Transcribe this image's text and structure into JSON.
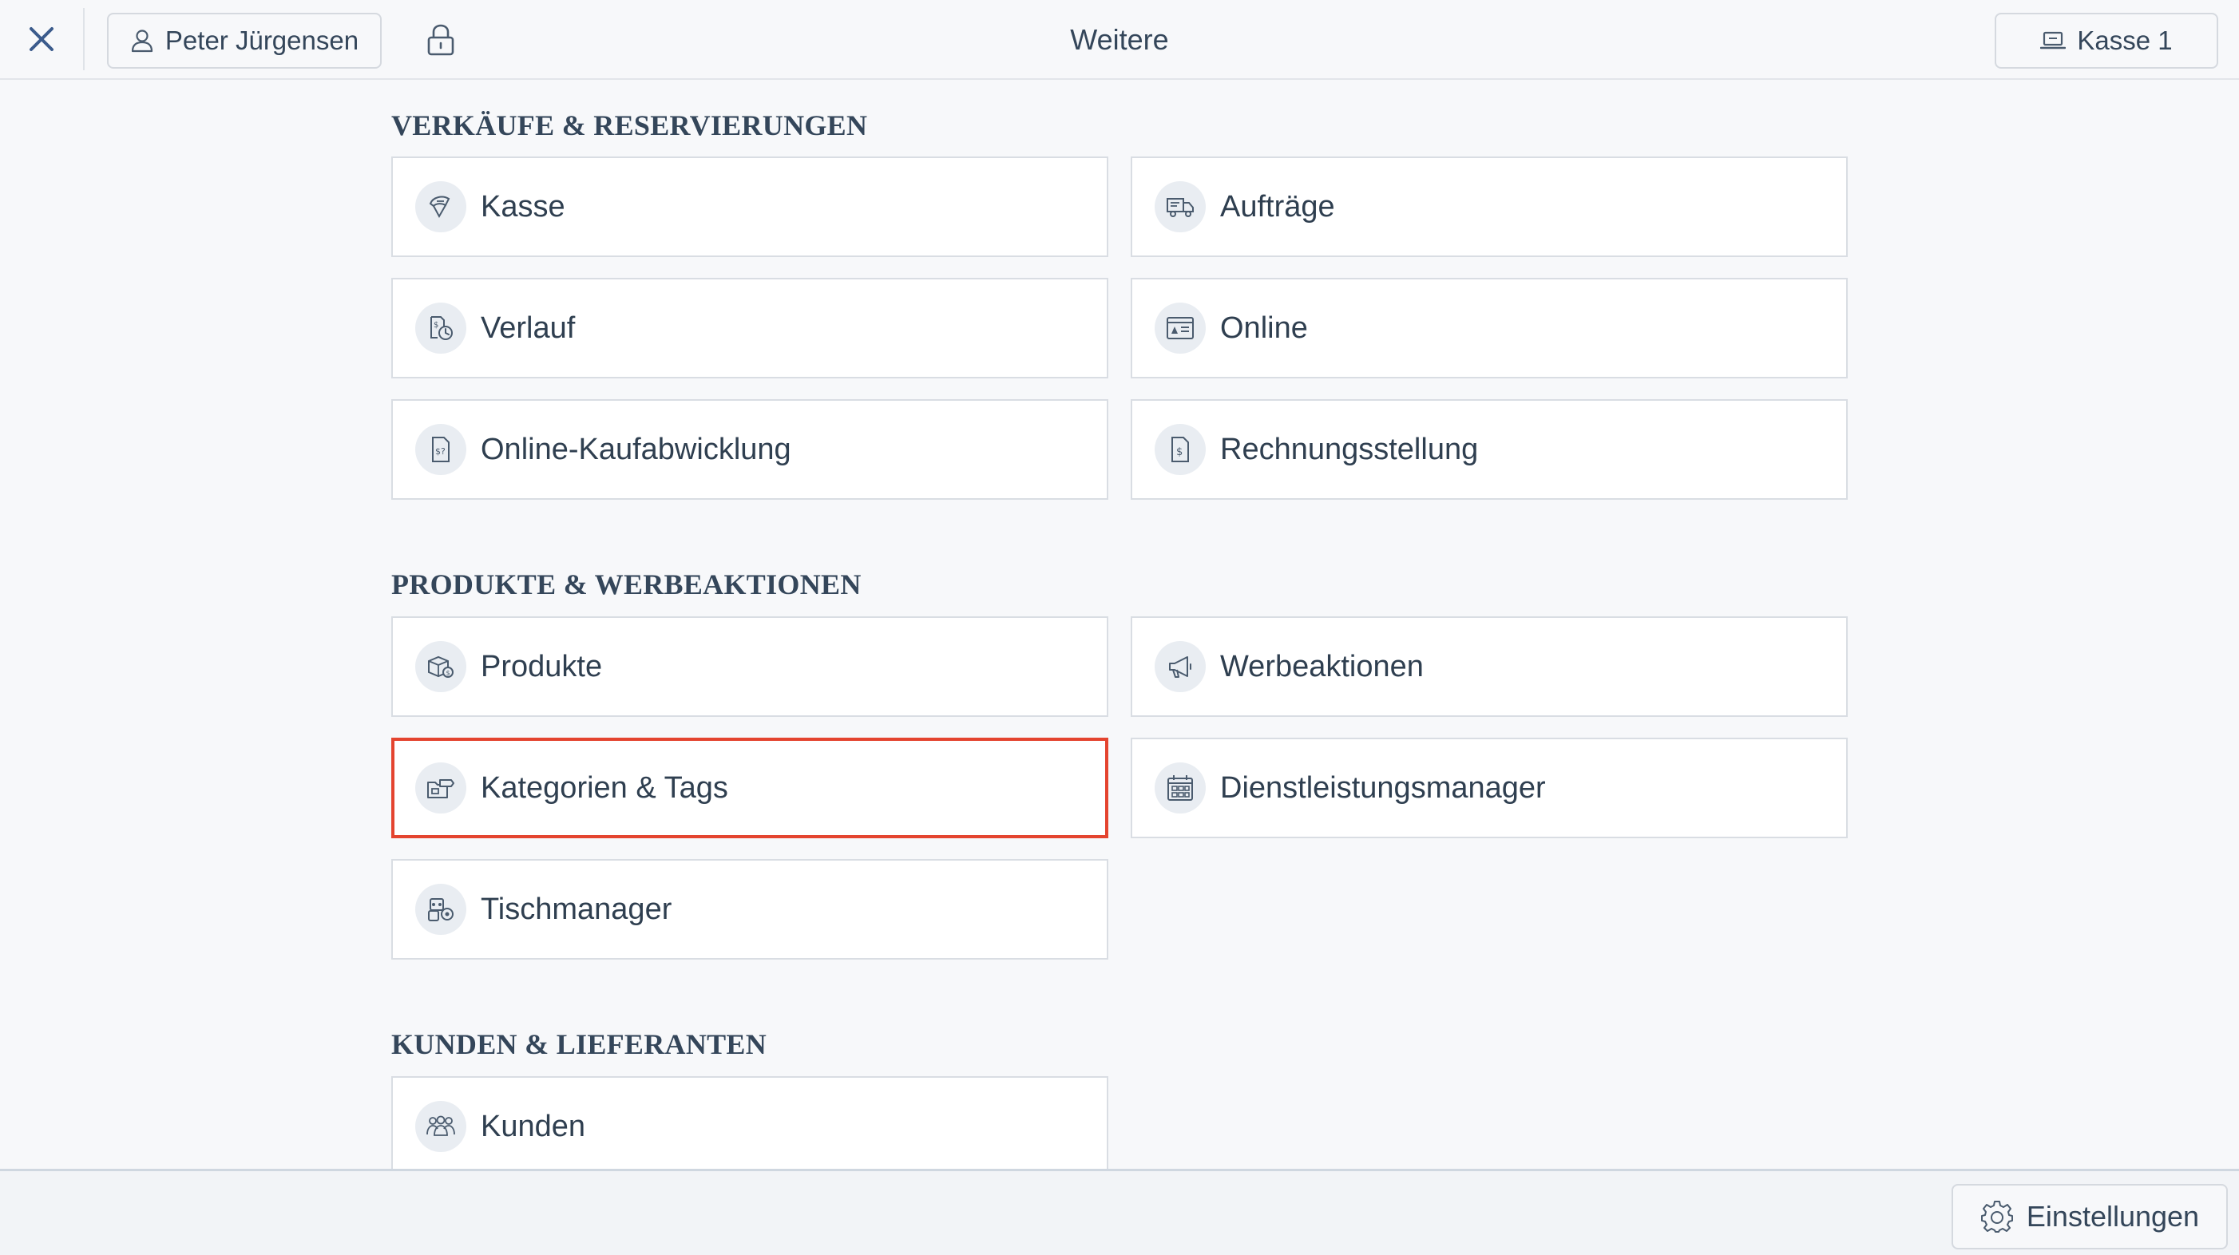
{
  "header": {
    "close_icon": "close-icon",
    "user_name": "Peter Jürgensen",
    "user_icon": "user-icon",
    "lock_icon": "lock-icon",
    "title": "Weitere",
    "register_label": "Kasse 1",
    "register_icon": "register-icon"
  },
  "sections": [
    {
      "title": "VERKÄUFE & RESERVIERUNGEN",
      "tiles": [
        {
          "label": "Kasse",
          "icon": "checkout-icon"
        },
        {
          "label": "Aufträge",
          "icon": "orders-truck-icon"
        },
        {
          "label": "Verlauf",
          "icon": "history-icon"
        },
        {
          "label": "Online",
          "icon": "online-icon"
        },
        {
          "label": "Online-Kaufabwicklung",
          "icon": "online-checkout-icon"
        },
        {
          "label": "Rechnungsstellung",
          "icon": "invoice-icon"
        }
      ]
    },
    {
      "title": "PRODUKTE & WERBEAKTIONEN",
      "tiles": [
        {
          "label": "Produkte",
          "icon": "products-icon"
        },
        {
          "label": "Werbeaktionen",
          "icon": "megaphone-icon"
        },
        {
          "label": "Kategorien & Tags",
          "icon": "categories-tags-icon",
          "selected": true
        },
        {
          "label": "Dienstleistungsmanager",
          "icon": "calendar-grid-icon"
        },
        {
          "label": "Tischmanager",
          "icon": "table-manager-icon"
        }
      ]
    },
    {
      "title": "KUNDEN & LIEFERANTEN",
      "tiles": [
        {
          "label": "Kunden",
          "icon": "customers-icon"
        }
      ]
    }
  ],
  "footer": {
    "settings_label": "Einstellungen",
    "settings_icon": "gear-icon"
  },
  "colors": {
    "background": "#f7f8fa",
    "tile_background": "#ffffff",
    "tile_border": "#d9dde3",
    "selected_border": "#e4442f",
    "text": "#2f3f50",
    "icon": "#4a5b6e",
    "accent_blue": "#3b5b8c"
  }
}
